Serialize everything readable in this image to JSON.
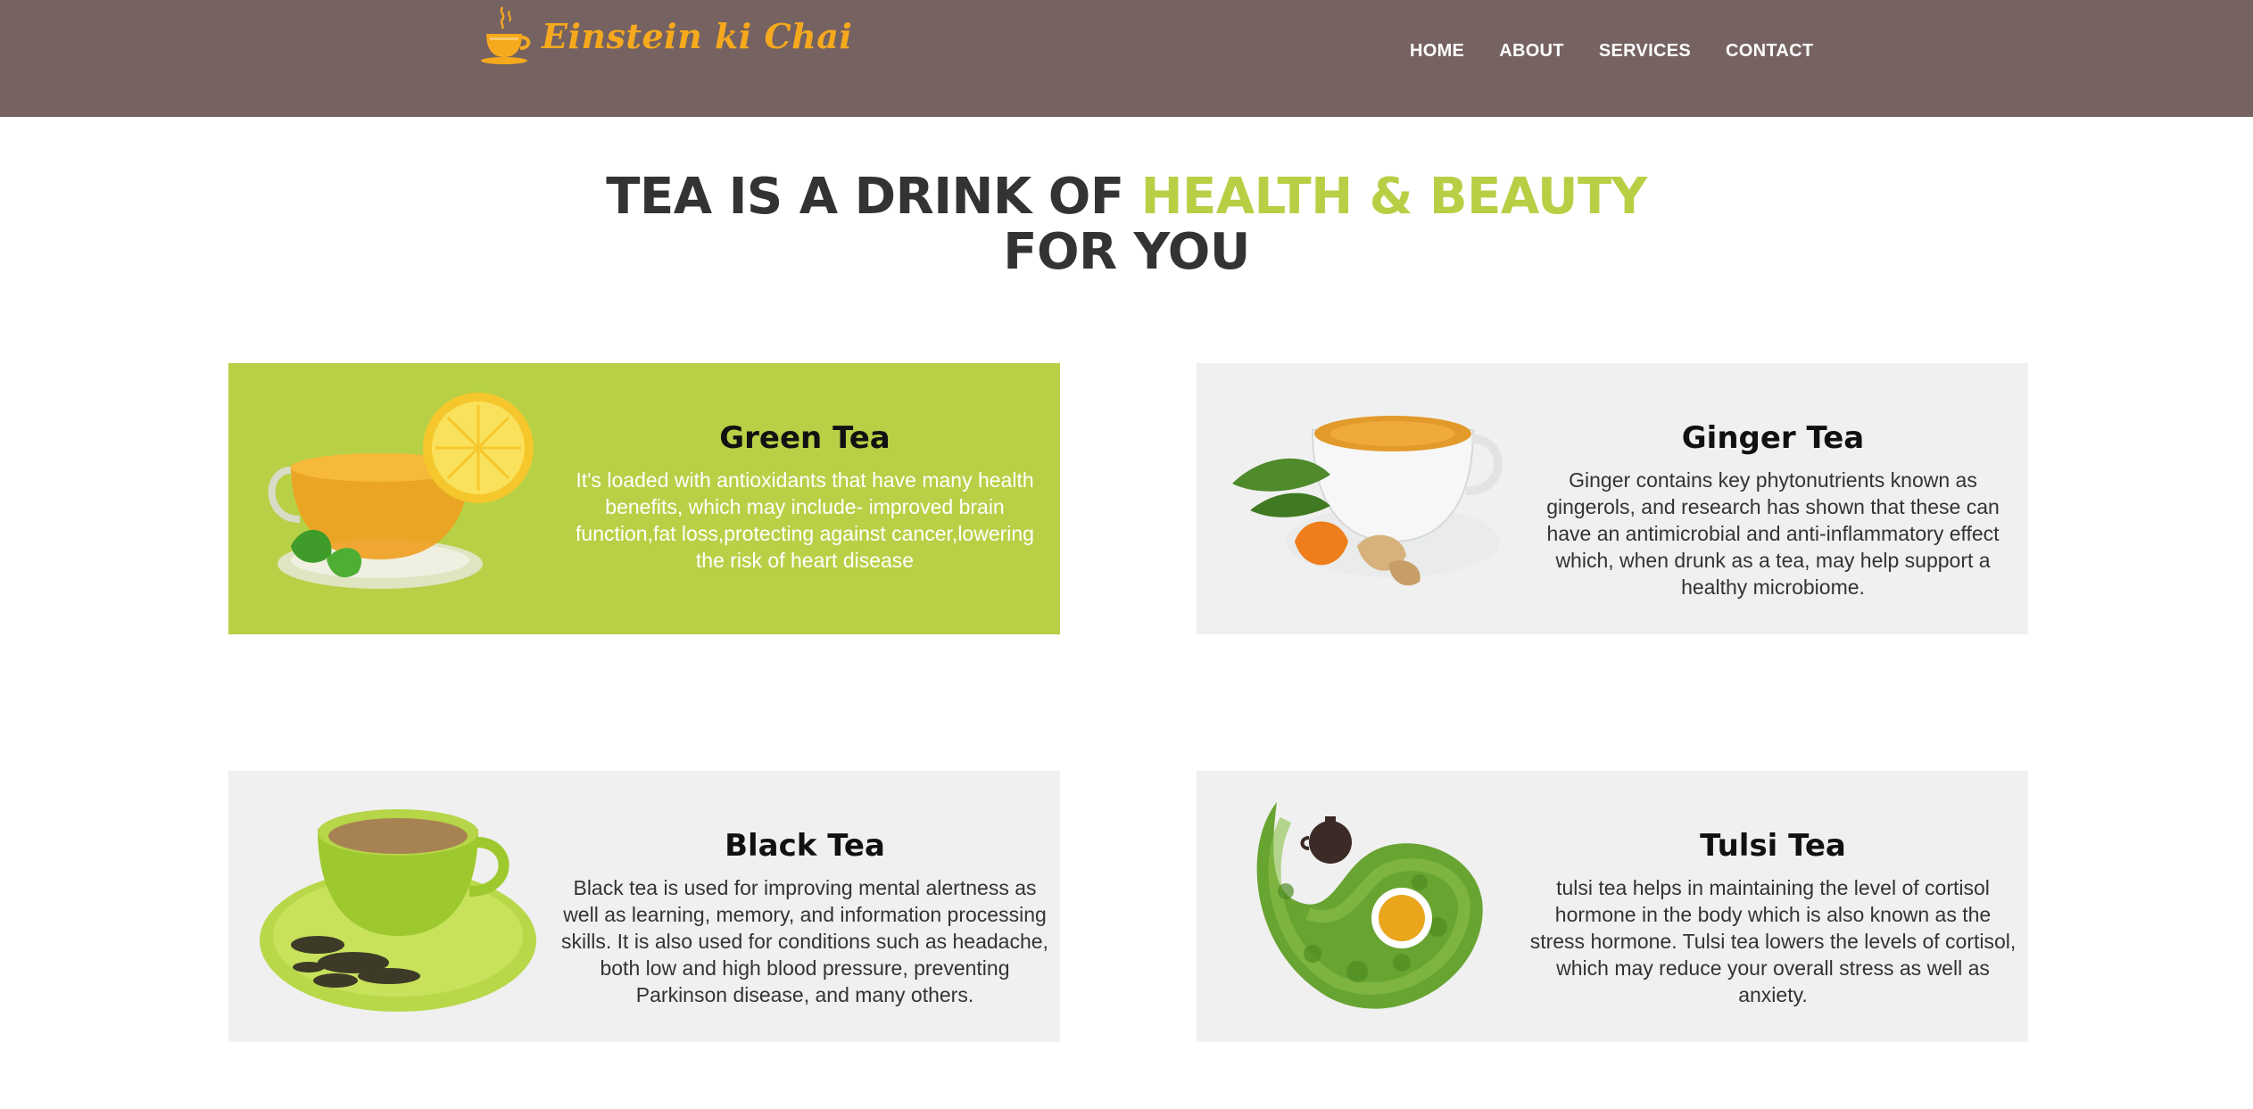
{
  "brand": {
    "name": "Einstein ki Chai",
    "icon": "tea-cup-logo-icon",
    "color": "#f6a91d"
  },
  "nav": {
    "items": [
      "HOME",
      "ABOUT",
      "SERVICES",
      "CONTACT"
    ]
  },
  "hero": {
    "line1_prefix": "TEA IS A DRINK OF ",
    "line1_accent": "HEALTH & BEAUTY",
    "line2": "FOR YOU",
    "accent_color": "#b8cf45"
  },
  "colors": {
    "header_bg": "#756261",
    "card_bg": "#f0f0f0",
    "card_highlight_bg": "#b8d046"
  },
  "cards": [
    {
      "title": "Green Tea",
      "image": "green-tea-cup-image",
      "desc": "It's loaded with antioxidants that have many health benefits, which may include- improved brain function,fat loss,protecting against cancer,lowering the risk of heart disease"
    },
    {
      "title": "Ginger Tea",
      "image": "ginger-tea-cup-image",
      "desc": "Ginger contains key phytonutrients known as gingerols, and research has shown that these can have an antimicrobial and anti-inflammatory effect which, when drunk as a tea, may help support a healthy microbiome."
    },
    {
      "title": "Black Tea",
      "image": "black-tea-cup-image",
      "desc": "Black tea is used for improving mental alertness as well as learning, memory, and information processing skills. It is also used for conditions such as headache, both low and high blood pressure, preventing Parkinson disease, and many others."
    },
    {
      "title": "Tulsi Tea",
      "image": "tulsi-tea-leaves-image",
      "desc": "tulsi tea helps in maintaining the level of cortisol hormone in the body which is also known as the stress hormone. Tulsi tea lowers the levels of cortisol, which may reduce your overall stress as well as anxiety."
    }
  ]
}
